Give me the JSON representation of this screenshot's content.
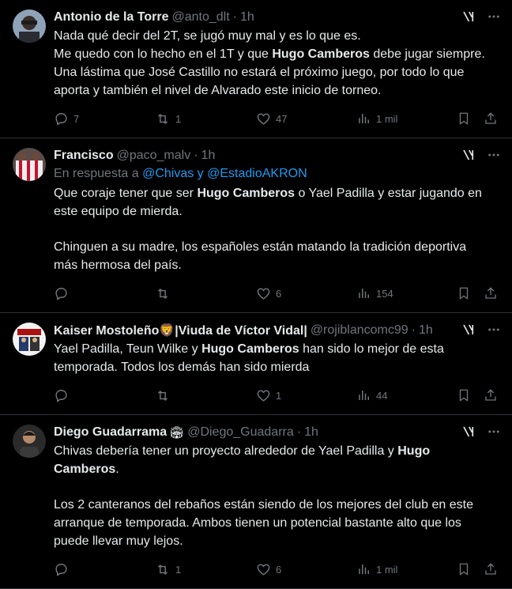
{
  "tweets": [
    {
      "name": "Antonio de la Torre",
      "handle": "@anto_dlt",
      "time": "1h",
      "reply_to": null,
      "paragraphs": [
        [
          "Nada qué decir del 2T, se jugó muy mal y es lo que es."
        ],
        [
          "Me quedo con lo hecho en el 1T y que ",
          {
            "b": "Hugo Camberos"
          },
          " debe jugar siempre."
        ],
        [
          "Una lástima que José Castillo no estará el próximo juego, por todo lo que"
        ],
        [
          "aporta y también el nivel de Alvarado este inicio de torneo."
        ]
      ],
      "replies": "7",
      "reposts": "1",
      "likes": "47",
      "views": "1 mil"
    },
    {
      "name": "Francisco",
      "handle": "@paco_malv",
      "time": "1h",
      "reply_to": {
        "prefix": "En respuesta a ",
        "mentions": "@Chivas y @EstadioAKRON"
      },
      "paragraphs": [
        [
          "Que coraje tener que ser ",
          {
            "b": "Hugo Camberos"
          },
          " o Yael Padilla y estar jugando en"
        ],
        [
          "este equipo de mierda."
        ],
        [],
        [
          "Chinguen a su madre, los españoles están matando la tradición deportiva"
        ],
        [
          "más hermosa del país."
        ]
      ],
      "replies": "",
      "reposts": "",
      "likes": "6",
      "views": "154"
    },
    {
      "name": "Kaiser Mostoleño🦁|Viuda de Víctor Vidal|",
      "handle": "@rojiblancomc99",
      "time": "1h",
      "reply_to": null,
      "paragraphs": [
        [
          "Yael Padilla, Teun Wilke y ",
          {
            "b": "Hugo Camberos"
          },
          " han sido lo mejor de esta"
        ],
        [
          "temporada. Todos los demás han sido mierda"
        ]
      ],
      "replies": "",
      "reposts": "",
      "likes": "1",
      "views": "44"
    },
    {
      "name": "Diego Guadarrama",
      "emoji": "🏟",
      "handle": "@Diego_Guadarra",
      "time": "1h",
      "reply_to": null,
      "paragraphs": [
        [
          "Chivas debería tener un proyecto alrededor de Yael Padilla y ",
          {
            "b": "Hugo"
          }
        ],
        [
          {
            "b": "Camberos"
          },
          "."
        ],
        [],
        [
          "Los 2 canteranos del rebaños están siendo de los mejores del club en este"
        ],
        [
          "arranque de temporada. Ambos tienen un potencial bastante alto que los"
        ],
        [
          "puede llevar muy lejos."
        ]
      ],
      "replies": "",
      "reposts": "1",
      "likes": "6",
      "views": "1 mil"
    }
  ],
  "colors": {
    "background": "#000000",
    "text": "#e7e9ea",
    "muted": "#71767b",
    "link": "#1d9bf0",
    "divider": "#2f3336"
  }
}
